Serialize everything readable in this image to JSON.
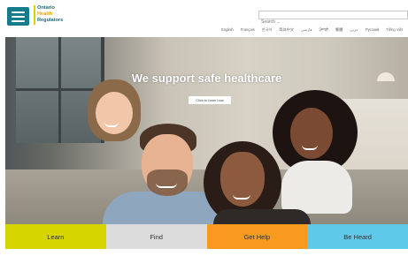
{
  "header": {
    "logo": {
      "line1": "Ontario",
      "line2": "Health",
      "line3": "Regulators"
    },
    "search": {
      "placeholder": "Search ..."
    },
    "languages": [
      "English",
      "Français",
      "한국어",
      "简体中文",
      "فارسی",
      "ਪੰਜਾਬੀ",
      "繁體",
      "عربى",
      "Русский",
      "Tiếng Việt"
    ]
  },
  "hero": {
    "title": "We support safe healthcare",
    "cta_label": "Click to learn how"
  },
  "tiles": [
    {
      "label": "Learn",
      "color": "#d6d500"
    },
    {
      "label": "Find",
      "color": "#dcdcdc"
    },
    {
      "label": "Get Help",
      "color": "#f79a1e"
    },
    {
      "label": "Be Heard",
      "color": "#5ec9e8"
    }
  ],
  "colors": {
    "brand": "#167b8b",
    "logo_accent": "#d6d300"
  }
}
